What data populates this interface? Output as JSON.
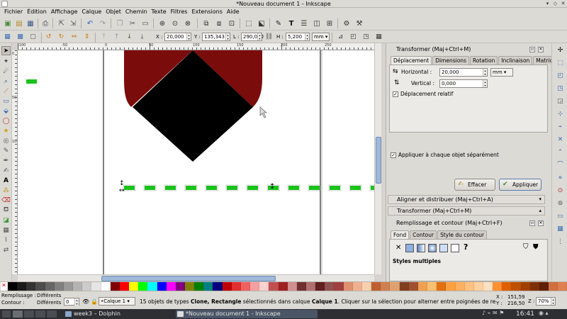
{
  "window": {
    "title": "*Nouveau document 1 - Inkscape"
  },
  "menu": [
    "Fichier",
    "Édition",
    "Affichage",
    "Calque",
    "Objet",
    "Chemin",
    "Texte",
    "Filtres",
    "Extensions",
    "Aide"
  ],
  "controls": {
    "x_label": "X :",
    "x_value": "20,000",
    "y_label": "Y :",
    "y_value": "135,343",
    "w_label": "L :",
    "w_value": "290,000",
    "h_label": "H :",
    "h_value": "5,200",
    "unit": "mm"
  },
  "dialog": {
    "title": "Transformer (Maj+Ctrl+M)",
    "tabs": [
      "Déplacement",
      "Dimensions",
      "Rotation",
      "Inclinaison",
      "Matrice"
    ],
    "horizontal_label": "Horizontal :",
    "horizontal_value": "20,000",
    "vertical_label": "Vertical :",
    "vertical_value": "0,000",
    "unit": "mm",
    "relative_label": "Déplacement relatif",
    "apply_each_label": "Appliquer à chaque objet séparément",
    "clear_label": "Effacer",
    "apply_label": "Appliquer"
  },
  "panels": {
    "align": "Aligner et distribuer (Maj+Ctrl+A)",
    "transform": "Transformer (Maj+Ctrl+M)",
    "fill": "Remplissage et contour (Maj+Ctrl+F)",
    "fill_tabs": [
      "Fond",
      "Contour",
      "Style du contour"
    ],
    "multi_styles": "Styles multiples",
    "unknown_mark": "?"
  },
  "ruler": {
    "top": [
      "-100",
      "-50",
      "0",
      "50",
      "100",
      "150",
      "200",
      "250"
    ],
    "left": [
      "0",
      "50",
      "100"
    ]
  },
  "status": {
    "fill_label": "Remplissage :",
    "fill_value": "Différents",
    "stroke_label": "Contour :",
    "stroke_value": "Différents",
    "opacity_value": "0",
    "layer": "•Calque 1",
    "message_a": "15 objets de types ",
    "message_b": "Clone, Rectangle",
    "message_c": " sélectionnés dans calque ",
    "message_d": "Calque 1",
    "message_e": ". Cliquer sur la sélection pour alterner entre poignées de re",
    "x_label": "X :",
    "x_value": "151,59",
    "y_label": "Y :",
    "y_value": "216,50",
    "zoom_label": "Z :",
    "zoom_value": "70%"
  },
  "taskbar": {
    "task1": "week3 – Dolphin",
    "task2": "*Nouveau document 1 - Inkscape",
    "time": "16:41"
  },
  "colors": {
    "heart": "#7b0c0c",
    "diamond": "#000000",
    "clones": "#19c31a",
    "palette": [
      "#000000",
      "#1a1a1a",
      "#333333",
      "#4d4d4d",
      "#666666",
      "#808080",
      "#999999",
      "#b3b3b3",
      "#cccccc",
      "#e6e6e6",
      "#ffffff",
      "#800000",
      "#ff0000",
      "#ffff00",
      "#00ff00",
      "#00ffff",
      "#0000ff",
      "#ff00ff",
      "#800080",
      "#808000",
      "#008000",
      "#008080",
      "#000080",
      "#c00000",
      "#e03030",
      "#f06060",
      "#f4a0a0",
      "#ffd0d0",
      "#c05050",
      "#a02020",
      "#d09090",
      "#703030",
      "#b07070",
      "#602020",
      "#905050",
      "#a04040",
      "#e09070",
      "#f0b090",
      "#f8d0b0",
      "#c06030",
      "#d08050",
      "#e0a070",
      "#804020",
      "#a05030",
      "#f0a050",
      "#f8c070",
      "#e07010",
      "#ffa040",
      "#ffb060",
      "#ffc080",
      "#ffd0a0",
      "#ffe0c0",
      "#ff9030",
      "#e06000",
      "#c05000",
      "#a04000",
      "#803000",
      "#602000",
      "#d07040",
      "#e08050"
    ]
  }
}
